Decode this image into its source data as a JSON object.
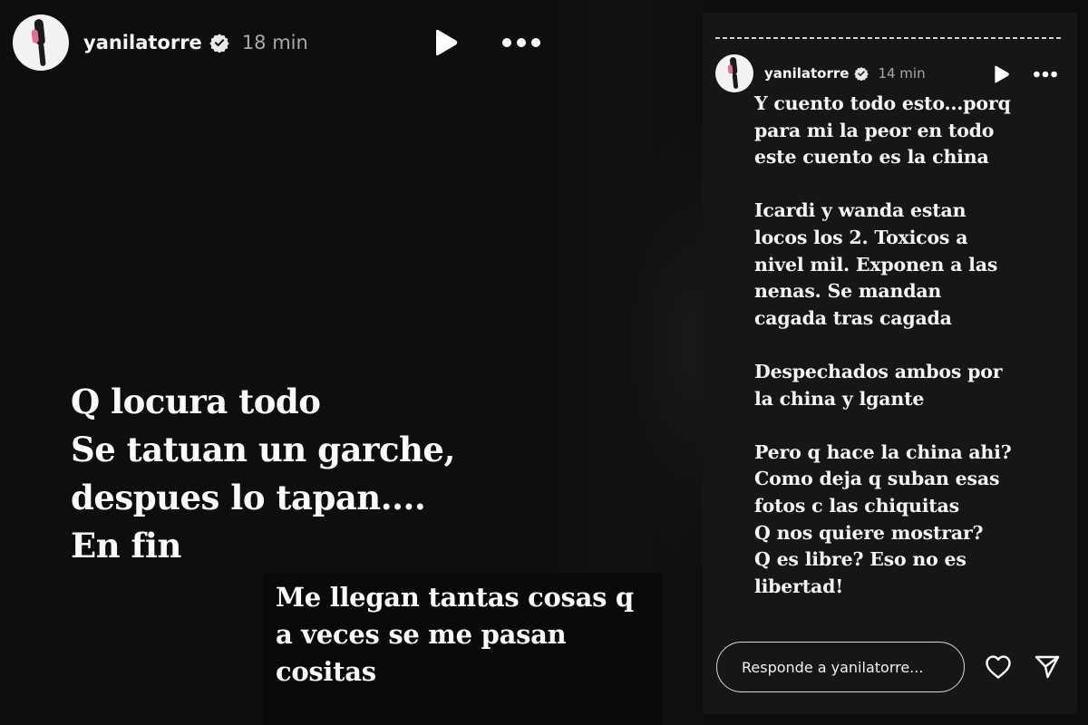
{
  "left_story": {
    "username": "yanilatorre",
    "time": "18 min",
    "text_main": "Q locura todo\nSe tatuan un garche,\ndespues lo tapan....\nEn fin",
    "text_sub": "Me llegan tantas cosas q\na veces se me pasan\ncositas"
  },
  "right_story": {
    "username": "yanilatorre",
    "time": "14 min",
    "paragraphs": [
      "Y cuento todo esto...porq\npara mi la peor en todo\neste cuento es la china",
      "Icardi y wanda estan\nlocos los 2. Toxicos a\nnivel mil. Exponen a las\nnenas. Se mandan\ncagada tras cagada",
      "Despechados ambos por\nla china y lgante",
      "Pero q hace la china ahi?\nComo deja q suban esas\nfotos c las chiquitas\nQ nos quiere mostrar?\nQ es libre? Eso no es\nlibertad!"
    ],
    "reply_placeholder": "Responde a yanilatorre..."
  },
  "icons": {
    "verified": "verified-badge-icon",
    "play": "play-icon",
    "more": "more-options-icon",
    "like": "heart-icon",
    "send": "send-icon"
  },
  "colors": {
    "background": "#0e0e0e",
    "story_panel": "#161616",
    "text": "#ffffff",
    "muted": "#a9a9a9"
  }
}
